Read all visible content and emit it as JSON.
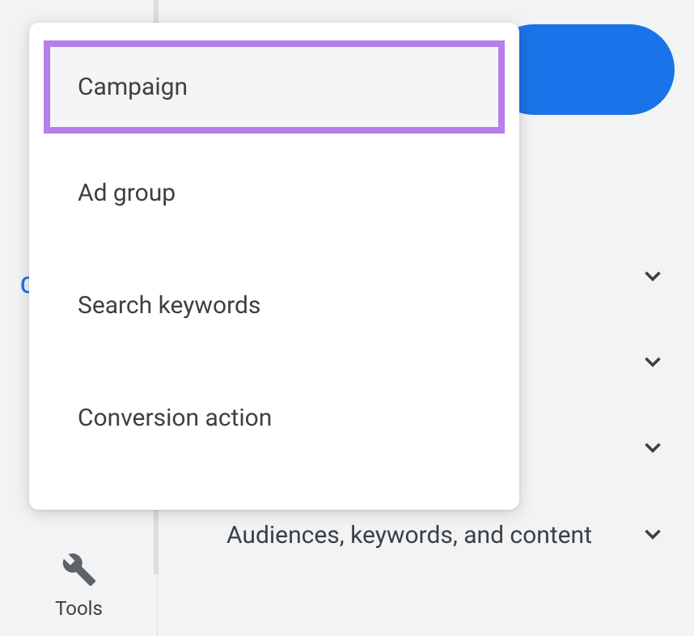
{
  "sidebar": {
    "partial_letter": "C",
    "tools_label": "Tools"
  },
  "dropdown": {
    "items": [
      {
        "label": "Campaign",
        "highlighted": true
      },
      {
        "label": "Ad group",
        "highlighted": false
      },
      {
        "label": "Search keywords",
        "highlighted": false
      },
      {
        "label": "Conversion action",
        "highlighted": false
      }
    ]
  },
  "main": {
    "rows": [
      {
        "label": ""
      },
      {
        "label": ""
      },
      {
        "label": ""
      },
      {
        "label": "Audiences, keywords, and content"
      }
    ]
  }
}
